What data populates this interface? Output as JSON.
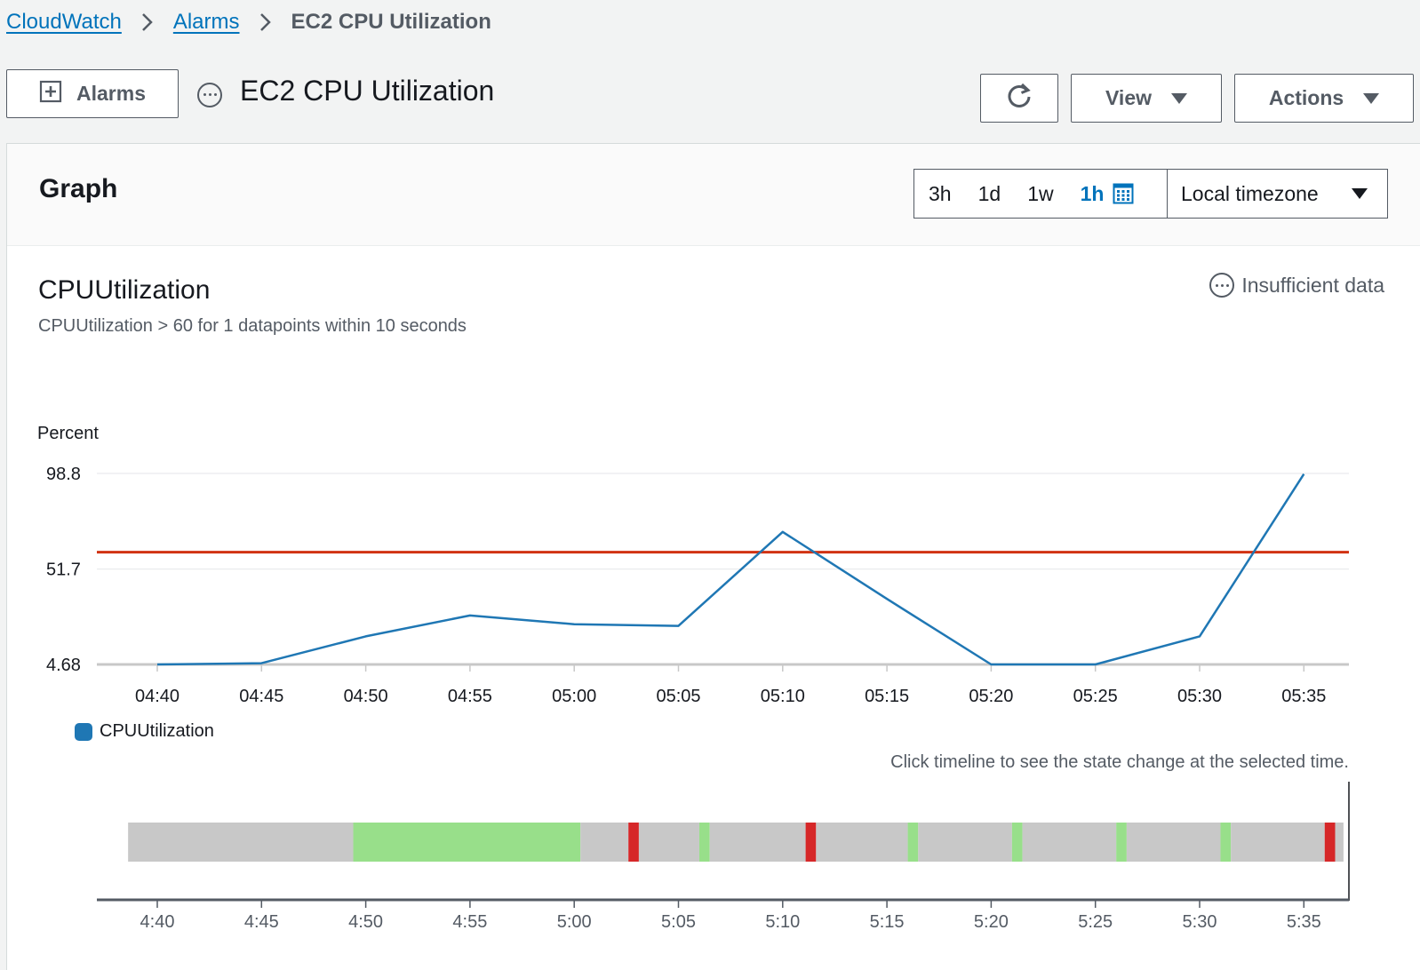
{
  "breadcrumb": {
    "items": [
      "CloudWatch",
      "Alarms"
    ],
    "current": "EC2 CPU Utilization"
  },
  "header": {
    "back_button_label": "Alarms",
    "title": "EC2 CPU Utilization",
    "view_label": "View",
    "actions_label": "Actions"
  },
  "panel": {
    "title": "Graph",
    "ranges": [
      "3h",
      "1d",
      "1w",
      "1h"
    ],
    "active_range": "1h",
    "timezone": "Local timezone"
  },
  "metric": {
    "title": "CPUUtilization",
    "description": "CPUUtilization > 60 for 1 datapoints within 10 seconds",
    "state": "Insufficient data",
    "legend_label": "CPUUtilization",
    "timeline_hint": "Click timeline to see the state change at the selected time."
  },
  "colors": {
    "series": "#1f77b4",
    "threshold": "#d13212",
    "ok": "#98df8a",
    "alarm": "#d62728",
    "insufficient": "#c8c8c8"
  },
  "chart_data": {
    "type": "line",
    "ylabel": "Percent",
    "yticks": [
      4.68,
      51.7,
      98.8
    ],
    "ylim": [
      4.68,
      98.8
    ],
    "threshold": 60,
    "x": [
      "04:40",
      "04:45",
      "04:50",
      "04:55",
      "05:00",
      "05:05",
      "05:10",
      "05:15",
      "05:20",
      "05:25",
      "05:30",
      "05:35"
    ],
    "series": [
      {
        "name": "CPUUtilization",
        "values": [
          4.7,
          5.3,
          18.5,
          28.8,
          24.5,
          23.7,
          70,
          37,
          4.7,
          4.7,
          18.5,
          98.5
        ]
      }
    ],
    "timeline": {
      "ticks": [
        "4:40",
        "4:45",
        "4:50",
        "4:55",
        "5:00",
        "5:05",
        "5:10",
        "5:15",
        "5:20",
        "5:25",
        "5:30",
        "5:35"
      ],
      "segments": [
        {
          "state": "insufficient",
          "start_min": 38.6,
          "end_min": 49.4
        },
        {
          "state": "ok",
          "start_min": 49.4,
          "end_min": 60.3
        },
        {
          "state": "insufficient",
          "start_min": 60.3,
          "end_min": 62.6
        },
        {
          "state": "alarm",
          "start_min": 62.6,
          "end_min": 63.1
        },
        {
          "state": "insufficient",
          "start_min": 63.1,
          "end_min": 66.0
        },
        {
          "state": "ok",
          "start_min": 66.0,
          "end_min": 66.5
        },
        {
          "state": "insufficient",
          "start_min": 66.5,
          "end_min": 71.1
        },
        {
          "state": "alarm",
          "start_min": 71.1,
          "end_min": 71.6
        },
        {
          "state": "insufficient",
          "start_min": 71.6,
          "end_min": 76.0
        },
        {
          "state": "ok",
          "start_min": 76.0,
          "end_min": 76.5
        },
        {
          "state": "insufficient",
          "start_min": 76.5,
          "end_min": 81.0
        },
        {
          "state": "ok",
          "start_min": 81.0,
          "end_min": 81.5
        },
        {
          "state": "insufficient",
          "start_min": 81.5,
          "end_min": 86.0
        },
        {
          "state": "ok",
          "start_min": 86.0,
          "end_min": 86.5
        },
        {
          "state": "insufficient",
          "start_min": 86.5,
          "end_min": 91.0
        },
        {
          "state": "ok",
          "start_min": 91.0,
          "end_min": 91.5
        },
        {
          "state": "insufficient",
          "start_min": 91.5,
          "end_min": 96.0
        },
        {
          "state": "alarm",
          "start_min": 96.0,
          "end_min": 96.5
        },
        {
          "state": "insufficient",
          "start_min": 96.5,
          "end_min": 96.9
        }
      ]
    }
  }
}
